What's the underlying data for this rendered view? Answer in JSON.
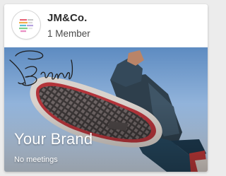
{
  "group": {
    "name": "JM&Co.",
    "member_count": "1 Member",
    "avatar_icon": "jm-co-logo-icon"
  },
  "cover": {
    "brand_title": "Your Brand",
    "status": "No meetings",
    "signature_icon": "brand-signature-icon",
    "image": "sneaker-sole-photo"
  },
  "colors": {
    "card_background": "#ffffff",
    "page_background": "#ececec",
    "sky_top": "#5b89bf",
    "sky_bottom": "#dbe7f5"
  }
}
